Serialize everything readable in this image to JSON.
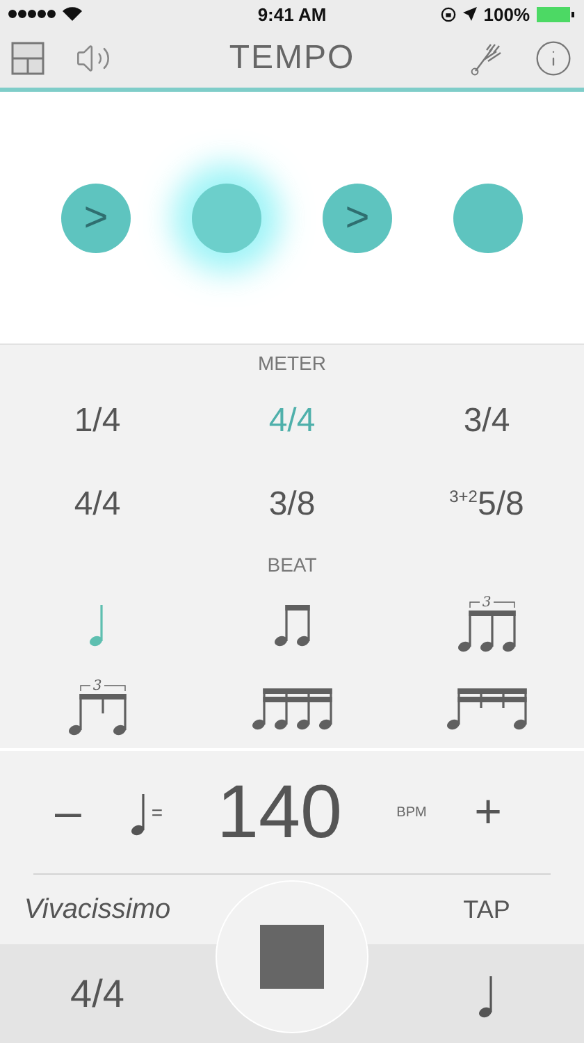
{
  "status_bar": {
    "time": "9:41 AM",
    "battery": "100%"
  },
  "nav": {
    "title": "TEMPO"
  },
  "beats": [
    {
      "mark": ">",
      "active": false
    },
    {
      "active": true
    },
    {
      "mark": ">",
      "active": false
    },
    {
      "active": false
    }
  ],
  "meter": {
    "label": "METER",
    "options": [
      {
        "label": "1/4",
        "selected": false
      },
      {
        "label": "4/4",
        "selected": true
      },
      {
        "label": "3/4",
        "selected": false
      },
      {
        "label": "4/4",
        "selected": false
      },
      {
        "label": "3/8",
        "selected": false
      },
      {
        "label": "$^{3+2}$5/8",
        "selected": false
      }
    ]
  },
  "beat": {
    "label": "BEAT",
    "options": [
      {
        "kind": "quarter",
        "selected": true
      },
      {
        "kind": "eighths",
        "selected": false
      },
      {
        "kind": "triplet",
        "tuplet": "3",
        "selected": false
      },
      {
        "kind": "shuffle",
        "tuplet": "3",
        "selected": false
      },
      {
        "kind": "sixteenths",
        "selected": false
      },
      {
        "kind": "gallop",
        "selected": false
      }
    ]
  },
  "tempo": {
    "minus": "–",
    "equals": "=",
    "value": "140",
    "unit": "BPM",
    "plus": "+"
  },
  "tempo_name": "Vivacissimo",
  "tap": "TAP",
  "footer": {
    "meter": "4/4"
  }
}
